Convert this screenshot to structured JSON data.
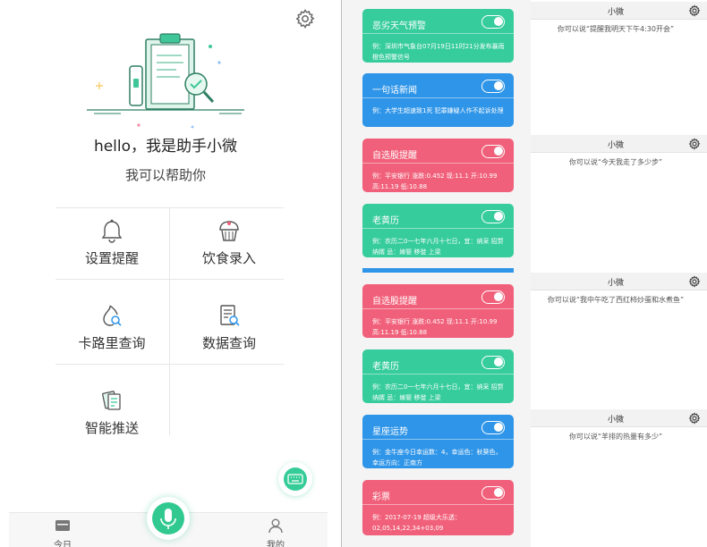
{
  "left": {
    "greeting": "hello，我是助手小微",
    "subtitle": "我可以帮助你",
    "features": [
      {
        "label": "设置提醒",
        "icon": "bell-icon"
      },
      {
        "label": "饮食录入",
        "icon": "cupcake-icon"
      },
      {
        "label": "卡路里查询",
        "icon": "flame-search-icon"
      },
      {
        "label": "数据查询",
        "icon": "document-search-icon"
      },
      {
        "label": "智能推送",
        "icon": "cards-push-icon"
      }
    ],
    "tabs": [
      {
        "label": "今日",
        "icon": "calendar-icon"
      },
      {
        "label": "我的",
        "icon": "user-icon"
      }
    ],
    "colors": {
      "accent": "#31c990"
    }
  },
  "middle": {
    "cards": [
      {
        "title": "恶劣天气预警",
        "body": "例：深圳市气象台07月19日11时21分发布暴雨橙色预警信号",
        "color": "green"
      },
      {
        "title": "一句话新闻",
        "body": "例：大学生超速致1死 犯罪嫌疑人作不起诉处理",
        "color": "blue"
      },
      {
        "title": "自选股提醒",
        "body": "例：平安银行 涨跌:0.452 现:11.1 开:10.99 高:11.19 低:10.88",
        "color": "red"
      },
      {
        "title": "老黄历",
        "body": "例：农历二0一七年六月十七日，宜：纳采 招赘 纳婿  忌：嫁娶 移徙 上梁",
        "color": "green"
      },
      {
        "title": "自选股提醒",
        "body": "例：平安银行 涨跌:0.452 现:11.1 开:10.99 高:11.19 低:10.88",
        "color": "red"
      },
      {
        "title": "老黄历",
        "body": "例：农历二0一七年六月十七日，宜：纳采 招赘 纳婿  忌：嫁娶 移徙 上梁",
        "color": "green"
      },
      {
        "title": "星座运势",
        "body": "例：金牛座今日幸运数：4，幸运色：秋葵色，幸运方向：正南方",
        "color": "blue"
      },
      {
        "title": "彩票",
        "body": "例：2017-07-19 超级大乐透：02,05,14,22,34+03,09",
        "color": "red"
      }
    ],
    "colors": {
      "green": "#36cc9c",
      "blue": "#2f95e8",
      "red": "#f1607a"
    }
  },
  "right": {
    "panels": [
      {
        "title": "小微",
        "hint": "你可以说“提醒我明天下午4:30开会”"
      },
      {
        "title": "小微",
        "hint": "你可以说“今天我走了多少步”"
      },
      {
        "title": "小微",
        "hint": "你可以说“我中午吃了西红柿炒蛋和水煮鱼”"
      },
      {
        "title": "小微",
        "hint": "你可以说“羊排的热量有多少”"
      }
    ]
  }
}
